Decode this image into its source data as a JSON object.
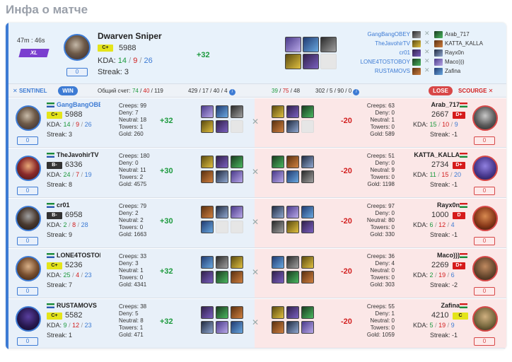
{
  "page_title": "Инфа о матче",
  "header": {
    "duration": "47m : 46s",
    "badge": "XL",
    "hero_name": "Dwarven Sniper",
    "rank": "C+",
    "rating": "5988",
    "kda_label": "KDA:",
    "kills": "14",
    "deaths": "9",
    "assists": "26",
    "sep1": "/",
    "sep2": "/",
    "streak": "Streak: 3",
    "counter": "0",
    "delta": "+32",
    "left_players": [
      "GangBangOBEY",
      "TheJavohirTV",
      "cr01",
      "LONE4TOSTOBOY",
      "RUSTAMOVS"
    ],
    "right_players": [
      "Arab_717",
      "KATTA_KALLA",
      "Rayx0n",
      "Maco)))",
      "Zafina"
    ]
  },
  "summary": {
    "sentinel": "SENTINEL",
    "win": "WIN",
    "total_label": "Общий счет:",
    "l_k": "74",
    "l_d": "40",
    "l_a": "119",
    "l_stats": "429 / 17 / 40 / 4",
    "r_k": "39",
    "r_d": "75",
    "r_a": "48",
    "r_stats": "302 / 5 / 90 / 0",
    "lose": "LOSE",
    "scourge": "SCOURGE",
    "slash": "/",
    "info": "i"
  },
  "rows": [
    {
      "left": {
        "name": "GangBangOBEY",
        "rank": "C+",
        "rating": "5988",
        "k": "14",
        "d": "9",
        "a": "26",
        "streak": "Streak: 3",
        "creeps": "Creeps: 99",
        "deny": "Deny: 7",
        "neutral": "Neutral: 18",
        "towers": "Towers: 1",
        "gold": "Gold: 260",
        "delta": "+32",
        "counter": "0"
      },
      "right": {
        "name": "Arab_717",
        "rank": "D+",
        "rating": "2667",
        "k": "15",
        "d": "10",
        "a": "9",
        "streak": "Streak: -1",
        "creeps": "Creeps: 63",
        "deny": "Deny: 0",
        "neutral": "Neutral: 1",
        "towers": "Towers: 0",
        "gold": "Gold: 589",
        "delta": "-20",
        "counter": "0"
      }
    },
    {
      "left": {
        "name": "TheJavohirTV",
        "rank": "B-",
        "rating": "6336",
        "k": "24",
        "d": "7",
        "a": "19",
        "streak": "Streak: 8",
        "creeps": "Creeps: 180",
        "deny": "Deny: 0",
        "neutral": "Neutral: 11",
        "towers": "Towers: 2",
        "gold": "Gold: 4575",
        "delta": "+30",
        "counter": "0"
      },
      "right": {
        "name": "KATTA_KALLA",
        "rank": "D+",
        "rating": "2734",
        "k": "11",
        "d": "15",
        "a": "20",
        "streak": "Streak: -1",
        "creeps": "Creeps: 51",
        "deny": "Deny: 0",
        "neutral": "Neutral: 9",
        "towers": "Towers: 0",
        "gold": "Gold: 1198",
        "delta": "-20",
        "counter": "0"
      }
    },
    {
      "left": {
        "name": "cr01",
        "rank": "B-",
        "rating": "6958",
        "k": "2",
        "d": "8",
        "a": "28",
        "streak": "Streak: 9",
        "creeps": "Creeps: 79",
        "deny": "Deny: 2",
        "neutral": "Neutral: 2",
        "towers": "Towers: 0",
        "gold": "Gold: 1663",
        "delta": "+30",
        "counter": "0"
      },
      "right": {
        "name": "Rayx0n",
        "rank": "D",
        "rating": "1000",
        "k": "6",
        "d": "12",
        "a": "4",
        "streak": "Streak: -1",
        "creeps": "Creeps: 97",
        "deny": "Deny: 0",
        "neutral": "Neutral: 80",
        "towers": "Towers: 0",
        "gold": "Gold: 330",
        "delta": "-20",
        "counter": "0"
      }
    },
    {
      "left": {
        "name": "LONE4TOSTOBOY",
        "rank": "C+",
        "rating": "5236",
        "k": "25",
        "d": "4",
        "a": "23",
        "streak": "Streak: 7",
        "creeps": "Creeps: 33",
        "deny": "Deny: 3",
        "neutral": "Neutral: 1",
        "towers": "Towers: 0",
        "gold": "Gold: 4341",
        "delta": "+32",
        "counter": "0"
      },
      "right": {
        "name": "Maco)))",
        "rank": "D+",
        "rating": "2269",
        "k": "2",
        "d": "19",
        "a": "6",
        "streak": "Streak: -2",
        "creeps": "Creeps: 36",
        "deny": "Deny: 4",
        "neutral": "Neutral: 0",
        "towers": "Towers: 0",
        "gold": "Gold: 303",
        "delta": "-20",
        "counter": "0"
      }
    },
    {
      "left": {
        "name": "RUSTAMOVS",
        "rank": "C+",
        "rating": "5582",
        "k": "9",
        "d": "12",
        "a": "23",
        "streak": "Streak: 1",
        "creeps": "Creeps: 38",
        "deny": "Deny: 5",
        "neutral": "Neutral: 8",
        "towers": "Towers: 1",
        "gold": "Gold: 471",
        "delta": "+32",
        "counter": "0"
      },
      "right": {
        "name": "Zafina",
        "rank": "C",
        "rating": "4210",
        "k": "5",
        "d": "19",
        "a": "9",
        "streak": "Streak: -1",
        "creeps": "Creeps: 55",
        "deny": "Deny: 1",
        "neutral": "Neutral: 0",
        "towers": "Towers: 0",
        "gold": "Gold: 1059",
        "delta": "-20",
        "counter": "0"
      }
    }
  ],
  "labels": {
    "kda": "KDA:",
    "slash": "/"
  },
  "colors": {
    "accent": "#3d7bd4",
    "win": "#1d9a3e",
    "lose": "#d21f1f",
    "xl": "#7a3fcf",
    "rank_c": "#e4e41a"
  }
}
